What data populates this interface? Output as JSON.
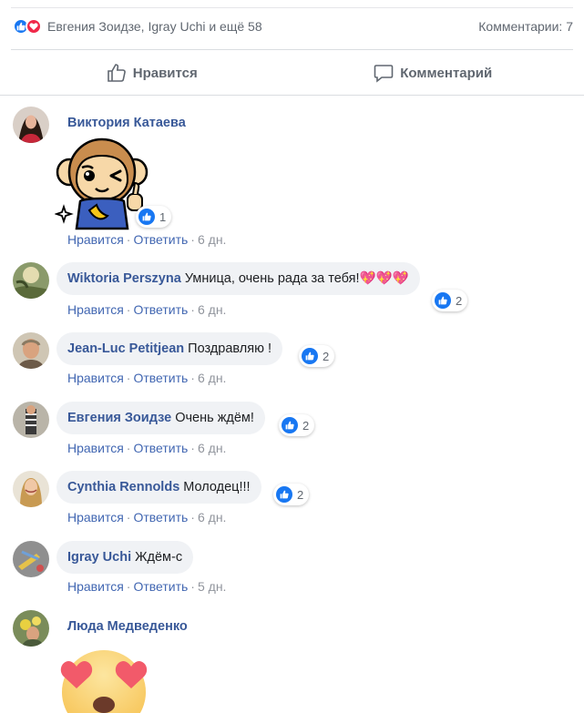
{
  "summary": {
    "names": "Евгения Зоидзе, Igray Uchi и ещё 58",
    "comments": "Комментарии: 7",
    "reaction_icons": [
      "like-icon",
      "love-icon"
    ]
  },
  "actions": {
    "like_label": "Нравится",
    "comment_label": "Комментарий"
  },
  "meta_labels": {
    "like": "Нравится",
    "reply": "Ответить",
    "sep": "·"
  },
  "comments": [
    {
      "author": "Виктория Катаева",
      "text": "",
      "sticker": "monkey-thumbs-up-sticker",
      "reactions": "1",
      "time": "6 дн."
    },
    {
      "author": "Wiktoria Perszyna",
      "text": "Умница, очень рада за тебя!💖💖💖",
      "reactions": "2",
      "time": "6 дн."
    },
    {
      "author": "Jean-Luc Petitjean",
      "text": "Поздравляю !",
      "reactions": "2",
      "time": "6 дн."
    },
    {
      "author": "Евгения Зоидзе",
      "text": "Очень ждём!",
      "reactions": "2",
      "time": "6 дн."
    },
    {
      "author": "Cynthia Rennolds",
      "text": "Молодец!!!",
      "reactions": "2",
      "time": "6 дн."
    },
    {
      "author": "Igray Uchi",
      "text": "Ждём-с",
      "time": "5 дн."
    },
    {
      "author": "Люда Медведенко",
      "text": "",
      "sticker": "heart-eyes-emoji-sticker"
    }
  ],
  "colors": {
    "like_blue": "#1877f2",
    "love_red": "#f02849",
    "author_link": "#385898",
    "bubble_bg": "#f0f2f5"
  }
}
